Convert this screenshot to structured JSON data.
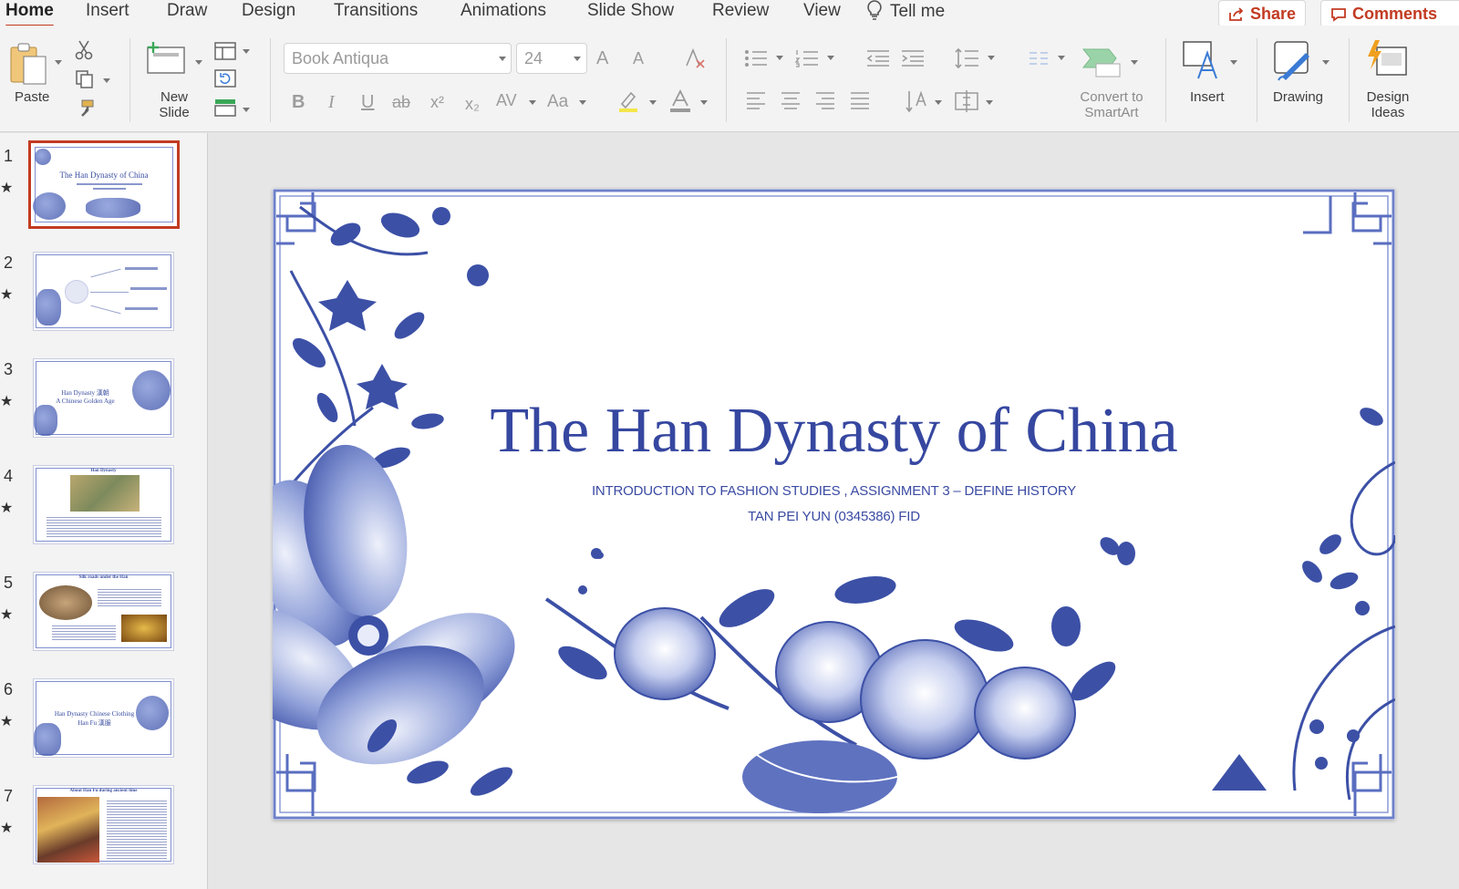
{
  "menu": {
    "tabs": [
      "Home",
      "Insert",
      "Draw",
      "Design",
      "Transitions",
      "Animations",
      "Slide Show",
      "Review",
      "View"
    ],
    "tell_me": "Tell me",
    "share": "Share",
    "comments": "Comments"
  },
  "ribbon": {
    "paste": "Paste",
    "new_slide": "New Slide",
    "font_name": "Book Antiqua",
    "font_size": "24",
    "convert_smartart": "Convert to SmartArt",
    "insert": "Insert",
    "drawing": "Drawing",
    "design_ideas": "Design Ideas",
    "bold": "B",
    "italic": "I",
    "underline": "U",
    "strike": "ab",
    "superscript": "x²",
    "subscript": "x₂",
    "spacing": "AV",
    "change_case": "Aa",
    "grow": "A",
    "shrink": "A"
  },
  "colors": {
    "accent": "#c23b22",
    "slide_blue": "#3647a0"
  },
  "slides": [
    {
      "number": "1",
      "star": "★",
      "title": "The Han Dynasty of China"
    },
    {
      "number": "2",
      "star": "★"
    },
    {
      "number": "3",
      "star": "★",
      "title": "Han Dynasty 漢朝",
      "subtitle": "A Chinese Golden Age"
    },
    {
      "number": "4",
      "star": "★",
      "title": "Han Dynasty"
    },
    {
      "number": "5",
      "star": "★",
      "title": "Silk roads under the Han"
    },
    {
      "number": "6",
      "star": "★",
      "title": "Han Dynasty Chinese Clothing",
      "subtitle": "Han Fu 漢服"
    },
    {
      "number": "7",
      "star": "★",
      "title": "About Han Fu during ancient time"
    }
  ],
  "slide": {
    "title": "The Han Dynasty of China",
    "subtitle1": "INTRODUCTION TO FASHION STUDIES , ASSIGNMENT 3 – DEFINE HISTORY",
    "subtitle2": "TAN PEI YUN (0345386) FID"
  }
}
